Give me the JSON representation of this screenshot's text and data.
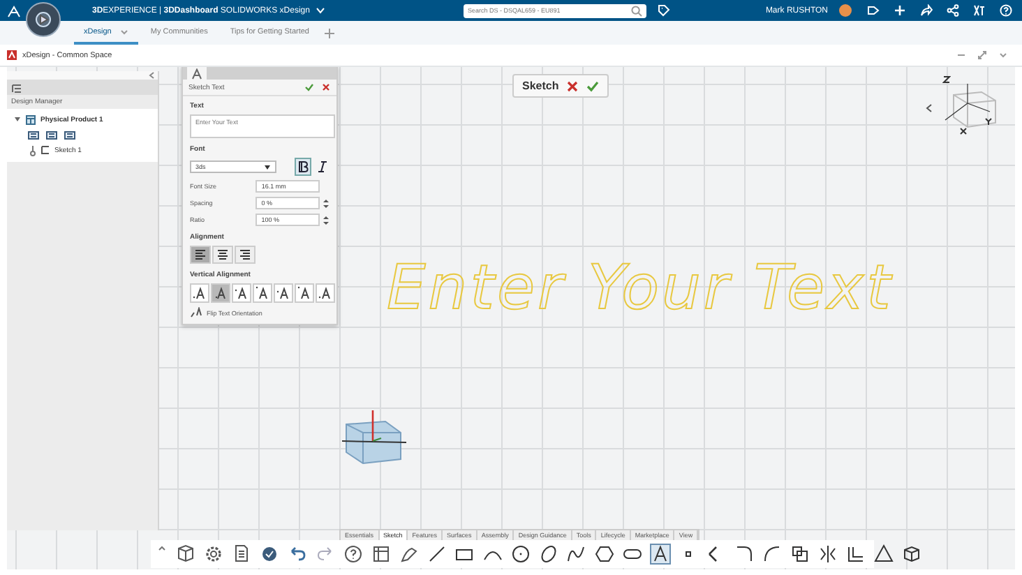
{
  "topbar": {
    "brand": "**3D**EXPERIENCE | **3DDashboard** SOLIDWORKS xDesign",
    "search": {
      "placeholder": "Search DS - DSQAL659 - EU891"
    },
    "user": "Mark RUSHTON"
  },
  "tabs": [
    {
      "label": "xDesign",
      "selected": true
    },
    {
      "label": "My Communities",
      "selected": false
    },
    {
      "label": "Tips for Getting Started",
      "selected": false
    }
  ],
  "space_title": "xDesign - Common Space",
  "design_manager": {
    "title": "Design Manager",
    "tree": [
      {
        "label": "Physical Product 1",
        "expanded": true,
        "children": [
          {
            "label": "Sketch 1"
          }
        ]
      }
    ]
  },
  "dialog": {
    "title": "Sketch Text",
    "text_label": "Text",
    "text_field": {
      "placeholder": "Enter Your Text"
    },
    "font_label": "Font",
    "font": "3ds",
    "bold": {
      "selected": true
    },
    "italic": {
      "selected": false
    },
    "fields": [
      {
        "label": "Font Size",
        "value": "16.1 mm",
        "kind": "plain"
      },
      {
        "label": "Spacing",
        "value": "0 %",
        "kind": "spinner"
      },
      {
        "label": "Ratio",
        "value": "100 %",
        "kind": "spinner"
      }
    ],
    "alignment_label": "Alignment",
    "alignment": [
      {
        "selected": true
      },
      {
        "selected": false
      },
      {
        "selected": false
      }
    ],
    "vertical_label": "Vertical Alignment",
    "vertical": [
      {
        "selected": false
      },
      {
        "selected": true
      },
      {
        "selected": false
      },
      {
        "selected": false
      },
      {
        "selected": false
      },
      {
        "selected": false
      },
      {
        "selected": false
      }
    ],
    "flip": "Flip Text Orientation"
  },
  "sketch_chip": {
    "label": "Sketch"
  },
  "canvas_text": "Enter Your Text",
  "command_tabs": [
    {
      "label": "Essentials",
      "selected": false
    },
    {
      "label": "Sketch",
      "selected": true
    },
    {
      "label": "Features",
      "selected": false
    },
    {
      "label": "Surfaces",
      "selected": false
    },
    {
      "label": "Assembly",
      "selected": false
    },
    {
      "label": "Design Guidance",
      "selected": false
    },
    {
      "label": "Tools",
      "selected": false
    },
    {
      "label": "Lifecycle",
      "selected": false
    },
    {
      "label": "Marketplace",
      "selected": false
    },
    {
      "label": "View",
      "selected": false
    }
  ]
}
